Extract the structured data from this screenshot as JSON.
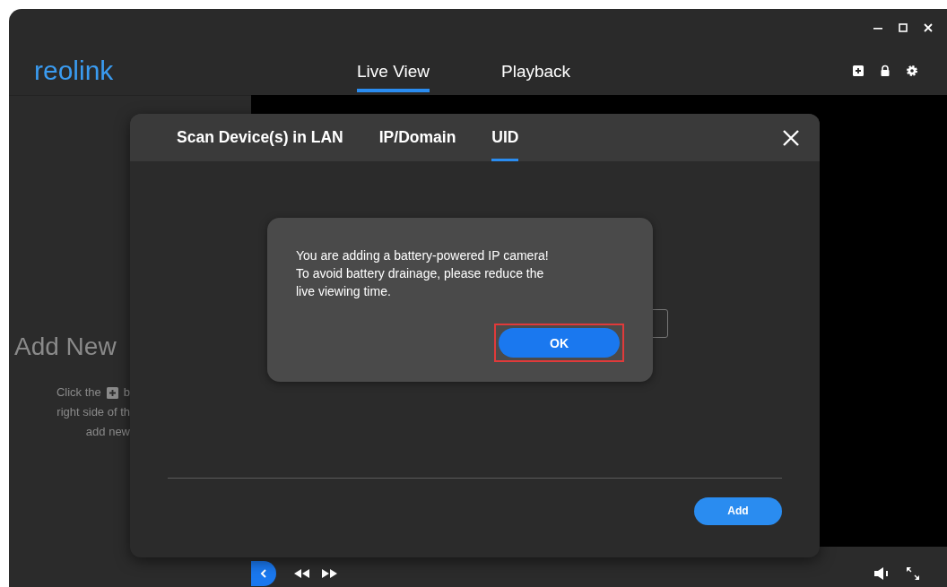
{
  "logo": "reolink",
  "nav_tabs": [
    {
      "label": "Live View",
      "selected": true
    },
    {
      "label": "Playback",
      "selected": false
    }
  ],
  "sidebar": {
    "title": "Add New",
    "hint_before_icon": "Click the",
    "hint_after_icon": "b",
    "hint_lines": [
      "right side of th",
      "add new"
    ]
  },
  "dialog": {
    "tabs": [
      {
        "label": "Scan Device(s) in LAN",
        "selected": false
      },
      {
        "label": "IP/Domain",
        "selected": false
      },
      {
        "label": "UID",
        "selected": true
      }
    ],
    "add_button": "Add"
  },
  "alert": {
    "message": "You are adding a battery-powered IP camera! To avoid battery drainage, please reduce the live viewing time.",
    "ok_button": "OK",
    "ok_highlighted": true
  }
}
